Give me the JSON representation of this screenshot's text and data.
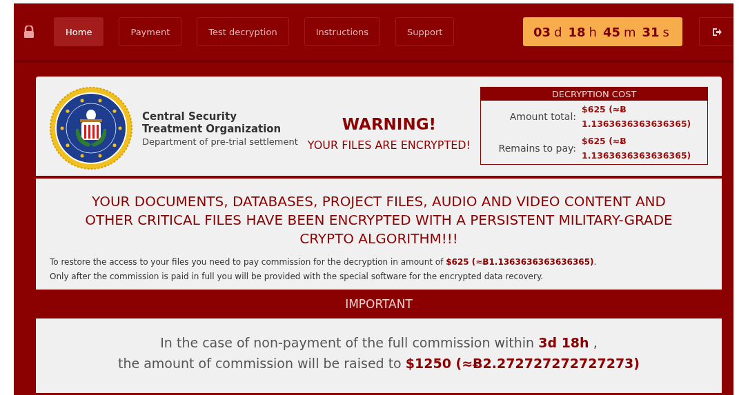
{
  "nav": {
    "items": [
      {
        "label": "Home",
        "selected": true
      },
      {
        "label": "Payment",
        "selected": false
      },
      {
        "label": "Test decryption",
        "selected": false
      },
      {
        "label": "Instructions",
        "selected": false
      },
      {
        "label": "Support",
        "selected": false
      }
    ],
    "countdown": [
      {
        "value": "03",
        "unit": "d"
      },
      {
        "value": "18",
        "unit": "h"
      },
      {
        "value": "45",
        "unit": "m"
      },
      {
        "value": "31",
        "unit": "s"
      }
    ]
  },
  "header": {
    "org_name": "Central Security Treatment Organization",
    "org_subtitle": "Department of pre-trial settlement",
    "warning_title": "WARNING!",
    "warning_text": "YOUR FILES ARE ENCRYPTED!",
    "cost": {
      "title": "DECRYPTION COST",
      "rows": [
        {
          "label": "Amount total:",
          "value": "$625 (≈Ƀ 1.1363636363636365)"
        },
        {
          "label": "Remains to pay:",
          "value": "$625 (≈Ƀ 1.1363636363636365)"
        }
      ]
    }
  },
  "message": {
    "headline": "YOUR DOCUMENTS, DATABASES, PROJECT FILES, AUDIO AND VIDEO CONTENT AND OTHER CRITICAL FILES HAVE BEEN ENCRYPTED WITH A PERSISTENT MILITARY-GRADE CRYPTO ALGORITHM!!!",
    "paragraphs": [
      "To restore the access to your files you need to pay commission for the decryption in amount of **$625 (≈Ƀ1.1363636363636365)**.",
      "Only after the commission is paid in full you will be provided with the special software for the encrypted data recovery."
    ]
  },
  "important": {
    "title": "IMPORTANT",
    "lines": [
      "In the case of non-payment of the full commission within **3d 18h** ,",
      "the amount of commission will be raised to **$1250 (≈Ƀ2.272727272727273)**"
    ]
  }
}
